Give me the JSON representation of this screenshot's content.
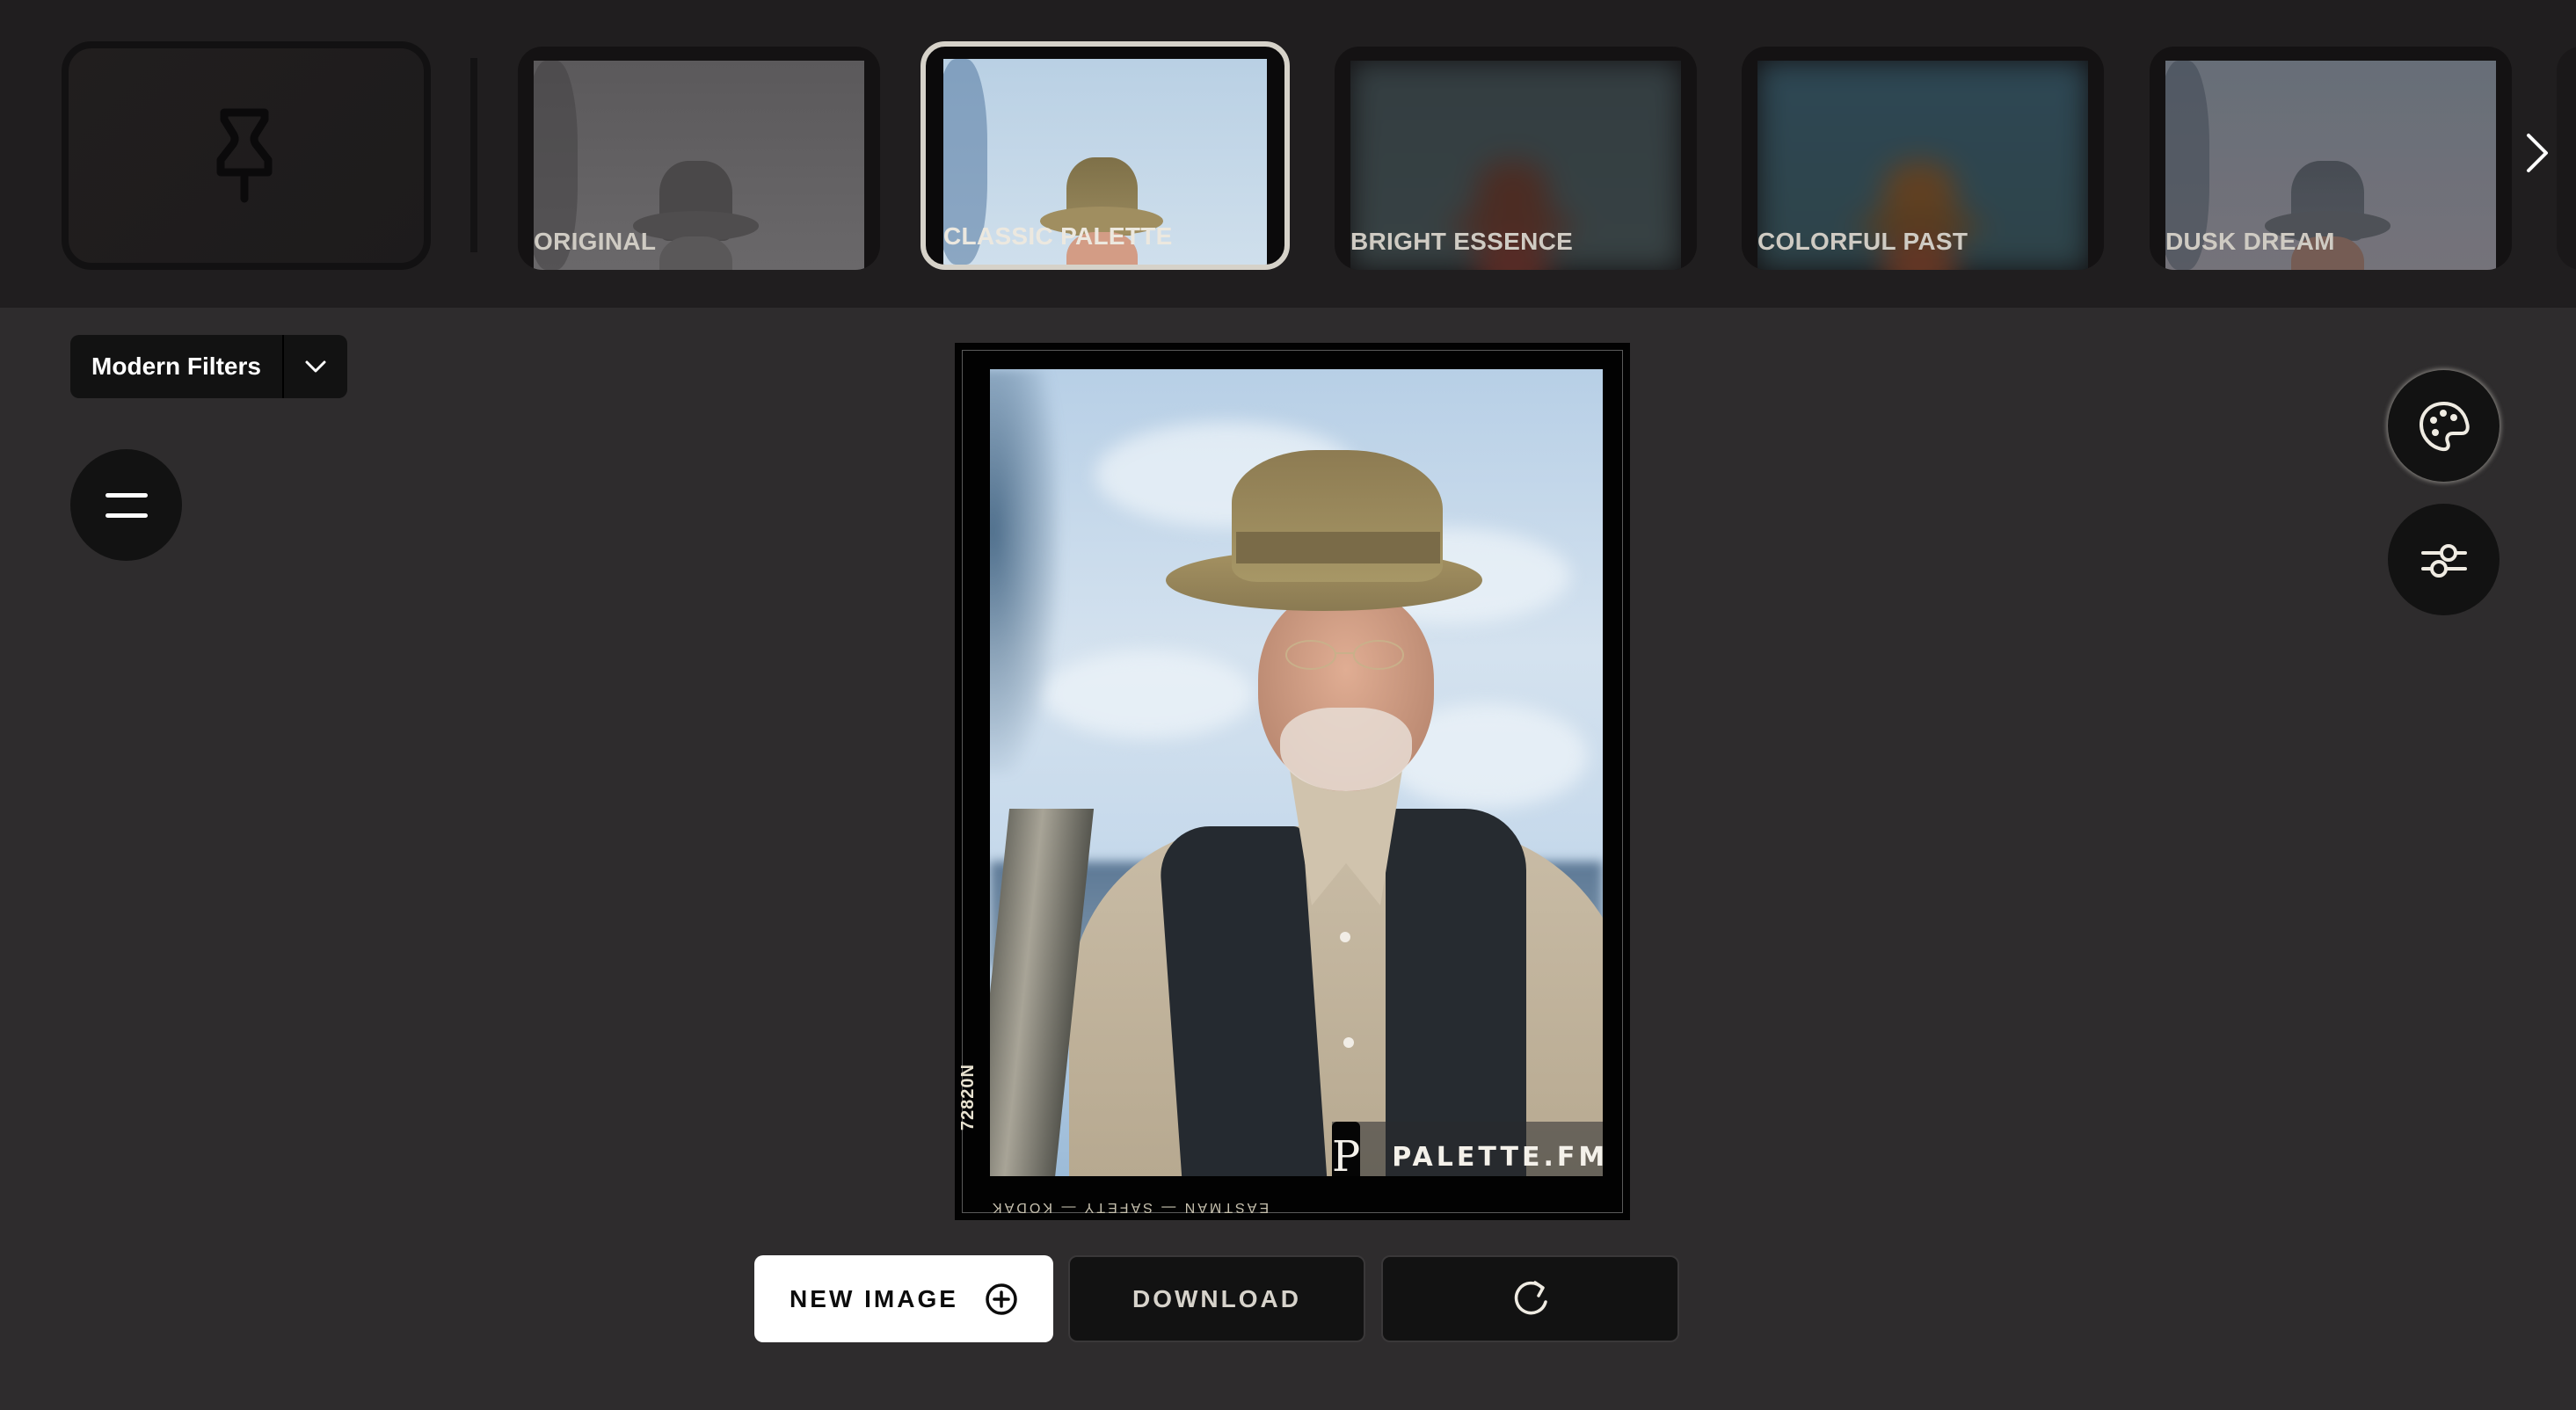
{
  "filter_strip": {
    "pin_card": {
      "icon": "pin-icon"
    },
    "filters": [
      {
        "label": "ORIGINAL",
        "state": "normal",
        "style": "grayscale"
      },
      {
        "label": "CLASSIC PALETTE",
        "state": "selected",
        "style": "color"
      },
      {
        "label": "BRIGHT ESSENCE",
        "state": "loading",
        "style": "blurred-warm"
      },
      {
        "label": "COLORFUL PAST",
        "state": "loading",
        "style": "blurred-vivid"
      },
      {
        "label": "DUSK DREAM",
        "state": "normal",
        "style": "dusk"
      }
    ],
    "next_icon": "chevron-right-icon"
  },
  "left_panel": {
    "filter_set": {
      "selected": "Modern Filters",
      "toggle_icon": "chevron-down-icon"
    },
    "menu_icon": "menu-icon"
  },
  "right_panel": {
    "tools": [
      {
        "name": "palette",
        "icon": "palette-icon",
        "active": true
      },
      {
        "name": "adjust",
        "icon": "sliders-icon",
        "active": false
      }
    ]
  },
  "photo": {
    "watermark_logo": "P",
    "watermark_text": "PALETTE.FM",
    "film_code": "72820N",
    "film_edge_text": "EASTMAN — SAFETY — KODAK"
  },
  "actions": {
    "new_image": "NEW IMAGE",
    "new_image_icon": "plus-circle-icon",
    "download": "DOWNLOAD",
    "refresh_icon": "refresh-icon"
  },
  "colors": {
    "strip_bg": "#201e1f",
    "main_bg": "#2e2c2d",
    "button_dark": "#121212",
    "selected_border": "#d6d2c9",
    "label_text": "#cfcbc3"
  }
}
